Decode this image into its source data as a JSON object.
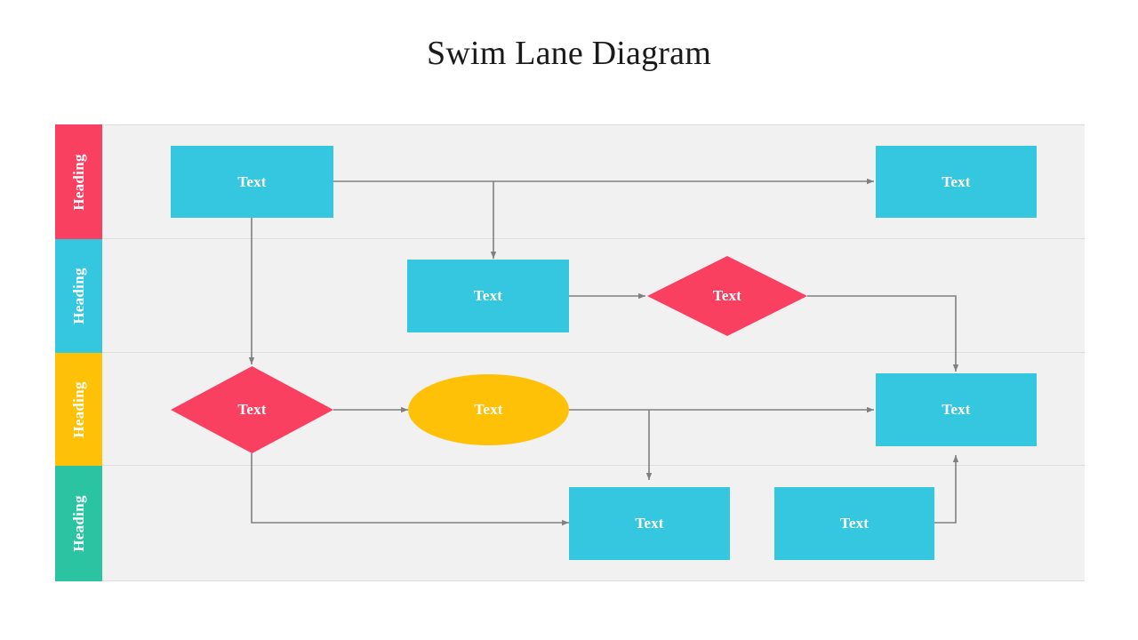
{
  "page": {
    "title": "Swim Lane Diagram",
    "background": "#ffffff"
  },
  "palette": {
    "cyan": "#35c6e0",
    "crimson": "#fa4061",
    "amber": "#ffc107",
    "teal": "#2bc4a3",
    "lane_bg": "#f1f1f1",
    "lane_divider": "#dcdcdc",
    "connector": "#808080",
    "label_text": "#ffffff",
    "title_text": "#1a1a1a"
  },
  "diagram": {
    "lanes": [
      {
        "id": "lane-1",
        "label": "Heading",
        "color": "#fa4061"
      },
      {
        "id": "lane-2",
        "label": "Heading",
        "color": "#35c6e0"
      },
      {
        "id": "lane-3",
        "label": "Heading",
        "color": "#ffc107"
      },
      {
        "id": "lane-4",
        "label": "Heading",
        "color": "#2bc4a3"
      }
    ],
    "nodes": [
      {
        "id": "n1",
        "lane": 1,
        "shape": "process",
        "label": "Text",
        "color": "#35c6e0"
      },
      {
        "id": "n2",
        "lane": 1,
        "shape": "process",
        "label": "Text",
        "color": "#35c6e0"
      },
      {
        "id": "n3",
        "lane": 2,
        "shape": "process",
        "label": "Text",
        "color": "#35c6e0"
      },
      {
        "id": "n4",
        "lane": 2,
        "shape": "decision",
        "label": "Text",
        "color": "#fa4061"
      },
      {
        "id": "n5",
        "lane": 3,
        "shape": "decision",
        "label": "Text",
        "color": "#fa4061"
      },
      {
        "id": "n6",
        "lane": 3,
        "shape": "terminator",
        "label": "Text",
        "color": "#ffc107"
      },
      {
        "id": "n7",
        "lane": 3,
        "shape": "process",
        "label": "Text",
        "color": "#35c6e0"
      },
      {
        "id": "n8",
        "lane": 4,
        "shape": "process",
        "label": "Text",
        "color": "#35c6e0"
      },
      {
        "id": "n9",
        "lane": 4,
        "shape": "process",
        "label": "Text",
        "color": "#35c6e0"
      }
    ]
  }
}
